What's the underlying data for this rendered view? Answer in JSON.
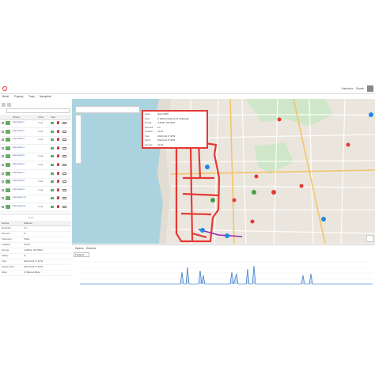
{
  "topbar": {
    "user_label": "Katarzyna",
    "user2_label": "Dymek"
  },
  "menu": [
    "Obiekt",
    "Pojazdy",
    "Trasy",
    "Narzędzia"
  ],
  "list": {
    "header": [
      "Obiekt",
      "Czas",
      "Stan"
    ],
    "rows": [
      {
        "name": "Kierowca 1",
        "time": "5 sek.",
        "color": "#6a6"
      },
      {
        "name": "Kierowca 2",
        "time": "3 sek.",
        "color": "#6a6"
      },
      {
        "name": "Kierowca 3",
        "time": "4 sek.",
        "color": "#6a6"
      },
      {
        "name": "Kierowca 4",
        "time": "",
        "color": "#6a6"
      },
      {
        "name": "Kierowca 5",
        "time": "4 sek.",
        "color": "#6a6"
      },
      {
        "name": "Kierowca 6",
        "time": "4 sek.",
        "color": "#6a6"
      },
      {
        "name": "Kierowca 7",
        "time": "",
        "color": "#6a6"
      },
      {
        "name": "Kierowca 8",
        "time": "4 sek.",
        "color": "#6a6"
      },
      {
        "name": "Kierowca 9",
        "time": "3 sek.",
        "color": "#6a6"
      },
      {
        "name": "Kierowca 10",
        "time": "",
        "color": "#6a6"
      },
      {
        "name": "Kierowca 11",
        "time": "4 sek.",
        "color": "#6a6"
      }
    ]
  },
  "pager": {
    "label": "1 z 1"
  },
  "props": {
    "header": [
      "Nazwa",
      "Wartość"
    ],
    "rows": [
      {
        "k": "Wysokość",
        "v": "0 m"
      },
      {
        "k": "Kierunek",
        "v": "0°"
      },
      {
        "k": "Połączenie",
        "v": "Online"
      },
      {
        "k": "Prędkość",
        "v": "0 km/h"
      },
      {
        "k": "Pozycja",
        "v": "-6.08741, 106.76531"
      },
      {
        "k": "Satelity",
        "v": "11"
      },
      {
        "k": "Czas",
        "v": "2019-10-21 17:42:52"
      },
      {
        "k": "Ostatnie dane",
        "v": "2019-10-21 17:42:52"
      },
      {
        "k": "Adres",
        "v": "Jl. Wahono Mulya"
      }
    ]
  },
  "popup": {
    "rows": [
      {
        "k": "Obiekt",
        "v": "Alam 471657"
      },
      {
        "k": "Adres",
        "v": "Jl. Wahono Mulya No.29, Penjaringan"
      },
      {
        "k": "Pozycja",
        "v": "-6.08741, 106.76531"
      },
      {
        "k": "Wysokość",
        "v": "0 m"
      },
      {
        "k": "Prędkość",
        "v": "0 km/h"
      },
      {
        "k": "Czas",
        "v": "2019-10-21 17:42:52"
      },
      {
        "k": "Odczyt",
        "v": "2019-10-21 17:42:52"
      },
      {
        "k": "Kierunek",
        "v": "0 km/h"
      }
    ]
  },
  "bottom": {
    "tab_graph": "Wykres",
    "tab_log": "Dziennik",
    "select": "Prędkość"
  }
}
